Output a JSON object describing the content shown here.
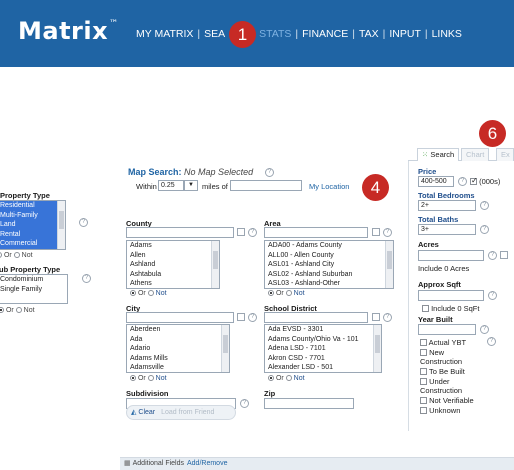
{
  "app": {
    "logo": "Matrix",
    "trademark": "™"
  },
  "nav": {
    "items": [
      "MY MATRIX",
      "SEA",
      "STATS",
      "FINANCE",
      "TAX",
      "INPUT",
      "LINKS"
    ],
    "separator": "|"
  },
  "callouts": {
    "one": "1",
    "four": "4",
    "six": "6"
  },
  "tabs": {
    "search": "Search",
    "chart": "Chart",
    "third": "Ex"
  },
  "left": {
    "property_type_label": "Property Type",
    "property_types": [
      "Residential",
      "Multi-Family",
      "Land",
      "Rental",
      "Commercial"
    ],
    "sub_type_label": "Sub Property Type",
    "sub_types": [
      "Condominium",
      "Single Family"
    ]
  },
  "map_search": {
    "label": "Map Search:",
    "status": "No Map Selected",
    "within_label": "Within",
    "within_value": "0.25",
    "miles_label": "miles of",
    "my_location": "My Location"
  },
  "county": {
    "label": "County",
    "options": [
      "Adams",
      "Allen",
      "Ashland",
      "Ashtabula",
      "Athens"
    ]
  },
  "area": {
    "label": "Area",
    "options": [
      "ADA00 - Adams County",
      "ALL00 - Allen County",
      "ASL01 - Ashland City",
      "ASL02 - Ashland Suburban",
      "ASL03 - Ashland-Other"
    ]
  },
  "city": {
    "label": "City",
    "options": [
      "Aberdeen",
      "Ada",
      "Adario",
      "Adams Mills",
      "Adamsville"
    ]
  },
  "school": {
    "label": "School District",
    "options": [
      "Ada EVSD - 3301",
      "Adams County/Ohio Va - 101",
      "Adena LSD - 7101",
      "Akron CSD - 7701",
      "Alexander LSD - 501"
    ]
  },
  "subdivision": {
    "label": "Subdivision"
  },
  "zip": {
    "label": "Zip"
  },
  "or_not": {
    "or": "Or",
    "not": "Not"
  },
  "price": {
    "label": "Price",
    "value": "400-500",
    "unit": "(000s)"
  },
  "bedrooms": {
    "label": "Total Bedrooms",
    "value": "2+"
  },
  "baths": {
    "label": "Total Baths",
    "value": "3+"
  },
  "acres": {
    "label": "Acres",
    "include": "Include 0 Acres"
  },
  "sqft": {
    "label": "Approx Sqft",
    "include": "Include 0 SqFt"
  },
  "year_built": {
    "label": "Year Built",
    "options": [
      "Actual YBT",
      "New Construction",
      "To Be Built",
      "Under Construction",
      "Not Verifiable",
      "Unknown"
    ]
  },
  "buttons": {
    "clear": "Clear",
    "load": "Load from Friend"
  },
  "additional": {
    "label": "Additional Fields",
    "link": "Add/Remove"
  }
}
